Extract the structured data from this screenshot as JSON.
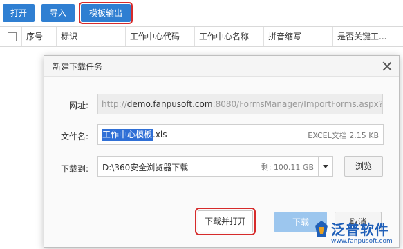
{
  "toolbar": {
    "open_label": "打开",
    "import_label": "导入",
    "template_export_label": "模板输出"
  },
  "grid": {
    "columns": [
      "序号",
      "标识",
      "工作中心代码",
      "工作中心名称",
      "拼音缩写",
      "是否关键工..."
    ]
  },
  "dialog": {
    "title": "新建下载任务",
    "url_label": "网址:",
    "url_prefix": "http://",
    "url_host": "demo.fanpusoft.com",
    "url_rest": ":8080/FormsManager/ImportForms.aspx?Fo",
    "filename_label": "文件名:",
    "filename_selected": "工作中心模板",
    "filename_ext": ".xls",
    "file_meta": "EXCEL文档 2.15 KB",
    "saveto_label": "下载到:",
    "saveto_path": "D:\\360安全浏览器下载",
    "free_space": "剩: 100.11 GB",
    "browse_label": "浏览",
    "download_open_label": "下载并打开",
    "download_label": "下载",
    "cancel_label": "取消"
  },
  "watermark": {
    "brand": "泛普软件",
    "url": "www.fanpusoft.com"
  },
  "colors": {
    "toolbar_button": "#2f7fd2",
    "highlight_outline": "#d62b2b",
    "download_button": "#9cc6ee",
    "watermark": "#1f5fb8"
  }
}
